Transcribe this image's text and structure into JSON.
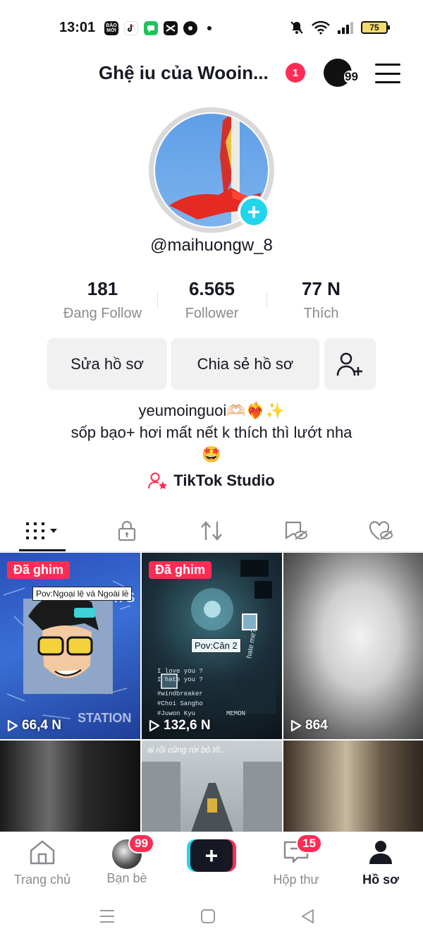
{
  "status_bar": {
    "time": "13:01",
    "app_icons": [
      "baomoi-icon",
      "tiktok-icon",
      "messages-icon",
      "capcut-icon",
      "chrome-icon"
    ],
    "baomoi_label": "BÁO MỚI",
    "battery": "75"
  },
  "header": {
    "title": "Ghệ iu của Wooin...",
    "notification_count": "1",
    "avatar_count": "99"
  },
  "profile": {
    "username": "@maihuongw_8",
    "stats": [
      {
        "value": "181",
        "label": "Đang Follow"
      },
      {
        "value": "6.565",
        "label": "Follower"
      },
      {
        "value": "77 N",
        "label": "Thích"
      }
    ],
    "edit_button": "Sửa hồ sơ",
    "share_button": "Chia sẻ hồ sơ",
    "bio_line1": "yeumoinguoi🫶🏻❤️‍🔥✨",
    "bio_line2": "sốp bạo+ hơi mất nết k thích thì lướt nha",
    "bio_line3": "🤩",
    "studio_label": "TikTok Studio"
  },
  "tabs": [
    "videos-grid-icon",
    "lock-icon",
    "repost-icon",
    "saved-hidden-icon",
    "liked-hidden-icon"
  ],
  "videos": [
    {
      "pinned_label": "Đã ghim",
      "views": "66,4 N",
      "overlay": "Pov:Ngoại lệ và Ngoài lề"
    },
    {
      "pinned_label": "Đã ghim",
      "views": "132,6 N",
      "overlay": "Pov:Cân 2"
    },
    {
      "pinned_label": "",
      "views": "864",
      "overlay": ""
    },
    {
      "pinned_label": "",
      "views": "",
      "overlay": ""
    },
    {
      "pinned_label": "",
      "views": "",
      "overlay": "ai rồi cũng rời bỏ tô..."
    },
    {
      "pinned_label": "",
      "views": "",
      "overlay": ""
    }
  ],
  "bottom_nav": {
    "home": "Trang chủ",
    "friends": "Bạn bè",
    "friends_badge": "99",
    "inbox": "Hộp thư",
    "inbox_badge": "15",
    "profile": "Hồ sơ"
  },
  "colors": {
    "accent_red": "#fe2c55",
    "accent_cyan": "#20d5ec",
    "text_primary": "#161823",
    "text_secondary": "#8a8b91"
  }
}
